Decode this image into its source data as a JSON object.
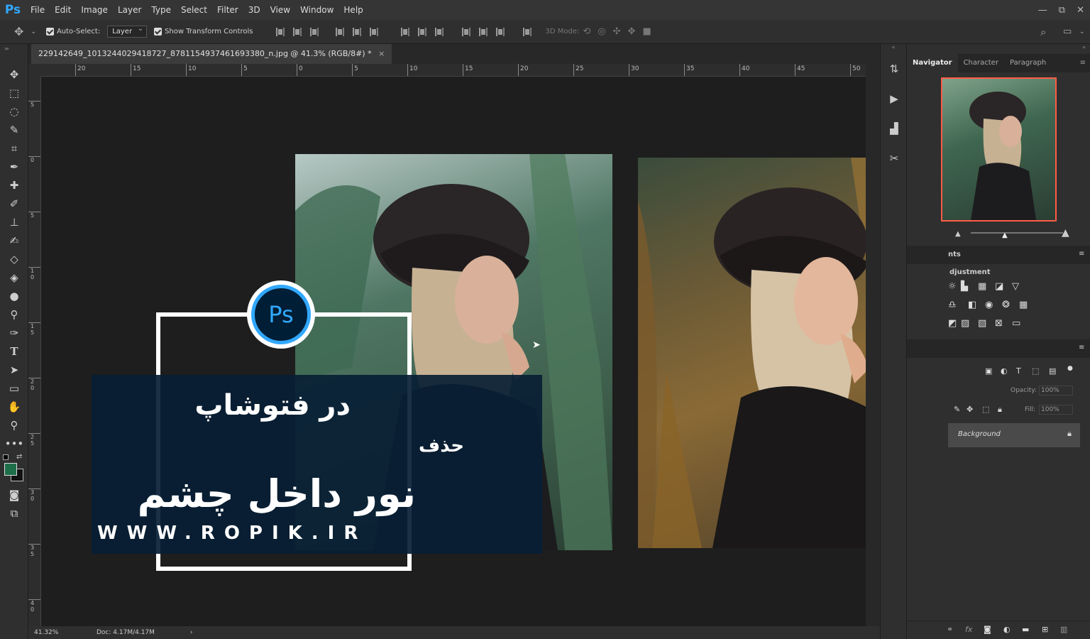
{
  "app": {
    "logo": "Ps"
  },
  "menu": [
    "File",
    "Edit",
    "Image",
    "Layer",
    "Type",
    "Select",
    "Filter",
    "3D",
    "View",
    "Window",
    "Help"
  ],
  "window_controls": {
    "minimize": "—",
    "restore": "⧉",
    "close": "✕"
  },
  "options_bar": {
    "auto_select_label": "Auto-Select:",
    "auto_select_target": "Layer",
    "show_transform_label": "Show Transform Controls",
    "mode_3d_label": "3D Mode:"
  },
  "document": {
    "tab_title": "229142649_1013244029418727_8781154937461693380_n.jpg @ 41.3% (RGB/8#) *",
    "close": "×"
  },
  "rulers": {
    "h_labels": [
      "20",
      "15",
      "10",
      "5",
      "0",
      "5",
      "10",
      "15",
      "20",
      "25",
      "30",
      "35",
      "40",
      "45",
      "50"
    ],
    "v_labels": [
      "5",
      "0",
      "5",
      "1\n0",
      "1\n5",
      "2\n0",
      "2\n5",
      "3\n0",
      "3\n5",
      "4\n0"
    ]
  },
  "status": {
    "zoom": "41.32%",
    "doc": "Doc: 4.17M/4.17M",
    "arrow": "›"
  },
  "overlay": {
    "title_line1": "در فتوشاپ",
    "title_line2": "حذف",
    "title_line3": "نور داخل چشم",
    "website": "WWW.ROPIK.IR",
    "badge": "Ps"
  },
  "panels": {
    "tabs": [
      "Navigator",
      "Character",
      "Paragraph"
    ],
    "adjust_tab_fragment": "nts",
    "adjust_label_fragment": "djustment",
    "opacity_label": "Opacity:",
    "opacity_value": "100%",
    "fill_label": "Fill:",
    "fill_value": "100%",
    "layer_name": "Background"
  },
  "colors": {
    "ps_blue": "#31a8ff",
    "banner": "#081e34",
    "nav_highlight": "#ff5c46",
    "foreground_swatch": "#1e6e4a"
  }
}
